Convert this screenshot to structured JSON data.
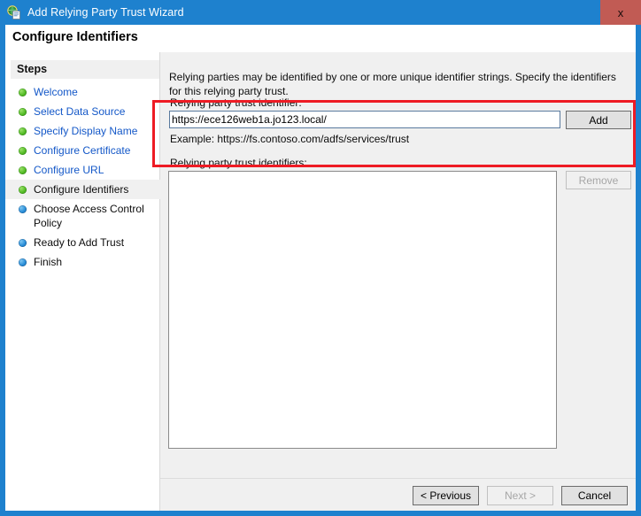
{
  "window": {
    "title": "Add Relying Party Trust Wizard",
    "icon": "wizard-globe-icon",
    "close_label": "x",
    "titlebar_color": "#1e81ce",
    "close_button_color": "#c15b54"
  },
  "header": {
    "title": "Configure Identifiers"
  },
  "sidebar": {
    "header": "Steps",
    "items": [
      {
        "label": "Welcome",
        "state": "done",
        "bullet": "green-dot-icon"
      },
      {
        "label": "Select Data Source",
        "state": "done",
        "bullet": "green-dot-icon"
      },
      {
        "label": "Specify Display Name",
        "state": "done",
        "bullet": "green-dot-icon"
      },
      {
        "label": "Configure Certificate",
        "state": "done",
        "bullet": "green-dot-icon"
      },
      {
        "label": "Configure URL",
        "state": "done",
        "bullet": "green-dot-icon"
      },
      {
        "label": "Configure Identifiers",
        "state": "current",
        "bullet": "green-dot-icon"
      },
      {
        "label": "Choose Access Control Policy",
        "state": "todo",
        "bullet": "blue-dot-icon"
      },
      {
        "label": "Ready to Add Trust",
        "state": "todo",
        "bullet": "blue-dot-icon"
      },
      {
        "label": "Finish",
        "state": "todo",
        "bullet": "blue-dot-icon"
      }
    ]
  },
  "main": {
    "intro": "Relying parties may be identified by one or more unique identifier strings. Specify the identifiers for this relying party trust.",
    "identifier_field": {
      "label": "Relying party trust identifier:",
      "value": "https://ece126web1a.jo123.local/",
      "placeholder": ""
    },
    "add_button": "Add",
    "example": "Example: https://fs.contoso.com/adfs/services/trust",
    "list_label": "Relying party trust identifiers:",
    "list_items": [],
    "remove_button": "Remove"
  },
  "annotation": {
    "color": "#ee1b24"
  },
  "footer": {
    "previous_label": "< Previous",
    "next_label": "Next >",
    "cancel_label": "Cancel"
  }
}
